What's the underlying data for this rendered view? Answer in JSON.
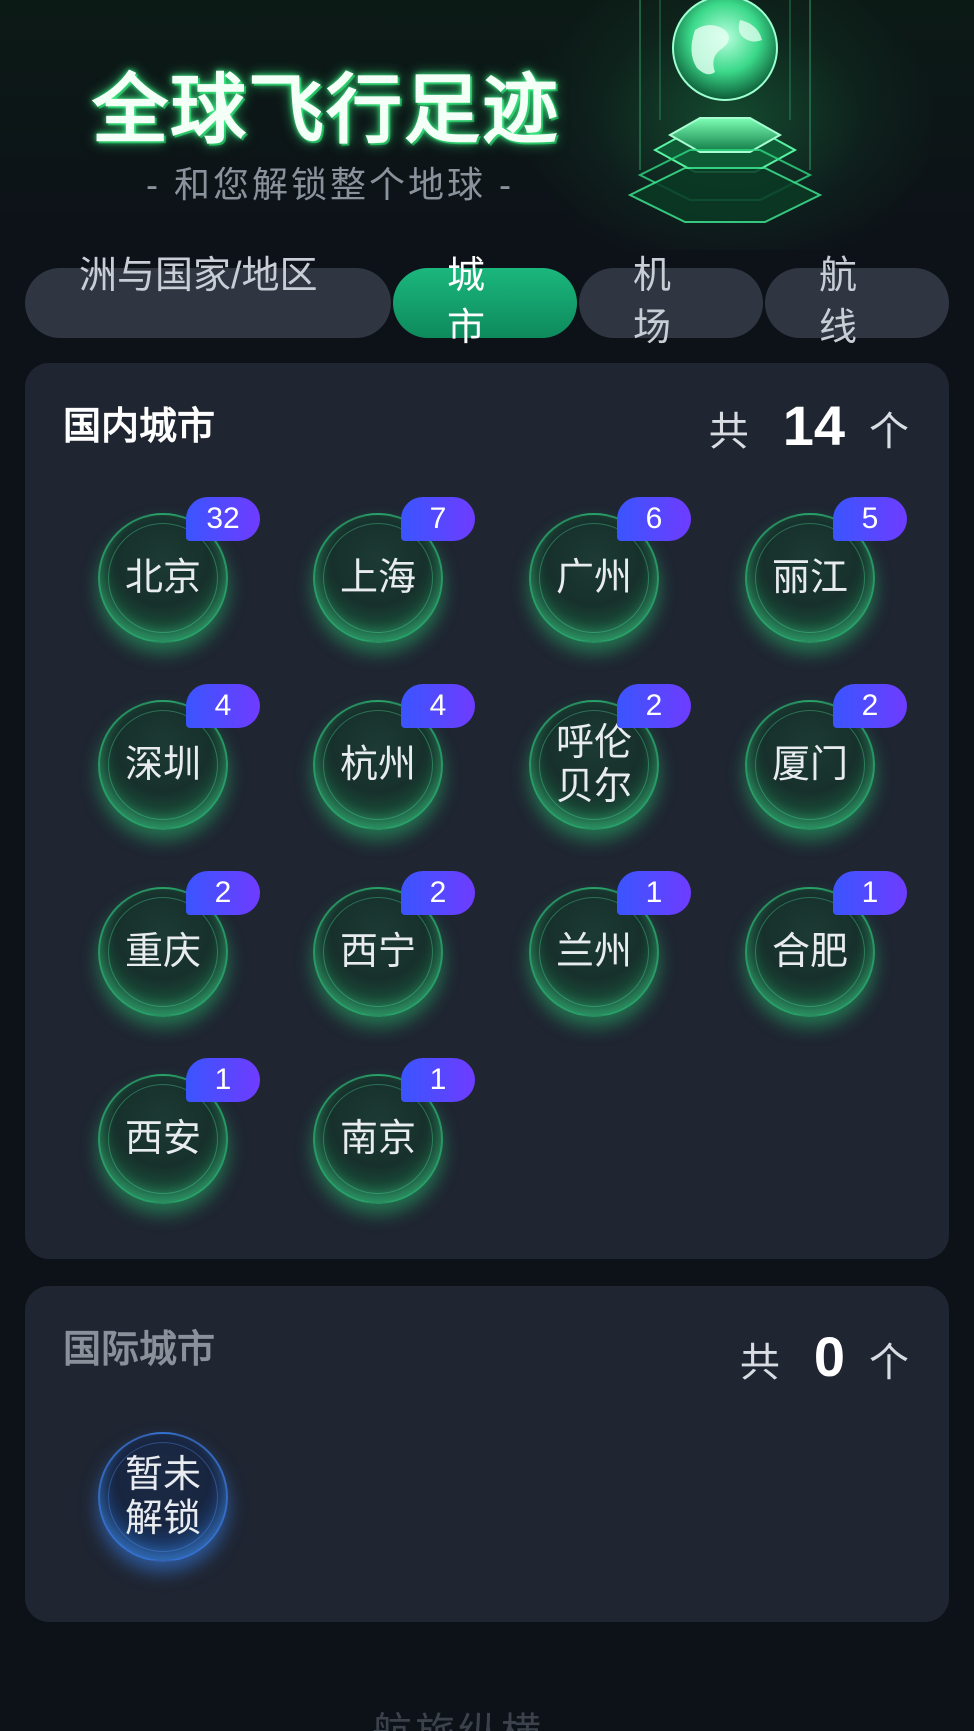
{
  "header": {
    "title": "全球飞行足迹",
    "subtitle": "- 和您解锁整个地球 -"
  },
  "tabs": [
    {
      "label": "洲与国家/地区",
      "active": false
    },
    {
      "label": "城市",
      "active": true
    },
    {
      "label": "机场",
      "active": false
    },
    {
      "label": "航线",
      "active": false
    }
  ],
  "domestic": {
    "title": "国内城市",
    "count_prefix": "共",
    "count": "14",
    "count_suffix": "个",
    "cities": [
      {
        "name": "北京",
        "visits": "32"
      },
      {
        "name": "上海",
        "visits": "7"
      },
      {
        "name": "广州",
        "visits": "6"
      },
      {
        "name": "丽江",
        "visits": "5"
      },
      {
        "name": "深圳",
        "visits": "4"
      },
      {
        "name": "杭州",
        "visits": "4"
      },
      {
        "name": "呼伦贝尔",
        "visits": "2"
      },
      {
        "name": "厦门",
        "visits": "2"
      },
      {
        "name": "重庆",
        "visits": "2"
      },
      {
        "name": "西宁",
        "visits": "2"
      },
      {
        "name": "兰州",
        "visits": "1"
      },
      {
        "name": "合肥",
        "visits": "1"
      },
      {
        "name": "西安",
        "visits": "1"
      },
      {
        "name": "南京",
        "visits": "1"
      }
    ]
  },
  "international": {
    "title": "国际城市",
    "count_prefix": "共",
    "count": "0",
    "count_suffix": "个",
    "locked_label": "暂未解锁"
  },
  "footer": {
    "brand": "航旅纵横"
  },
  "colors": {
    "accent_green": "#1bb77d",
    "badge_blue": "#3a55ff",
    "badge_purple": "#6f3cff",
    "panel": "#1f2531"
  }
}
